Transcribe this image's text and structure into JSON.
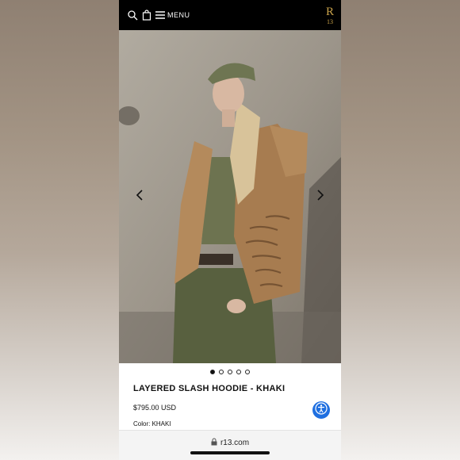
{
  "header": {
    "menu_label": "MENU",
    "logo_letter": "R",
    "logo_number": "13",
    "icons": [
      "search-icon",
      "shopping-bag-icon",
      "hamburger-icon"
    ]
  },
  "carousel": {
    "total_images": 5,
    "active_index": 0,
    "prev_icon": "chevron-left-icon",
    "next_icon": "chevron-right-icon"
  },
  "product": {
    "title": "LAYERED SLASH HOODIE - KHAKI",
    "price": "$795.00 USD",
    "color_label": "Color: KHAKI"
  },
  "accessibility_button": {
    "icon": "accessibility-icon",
    "color": "#1f6fe0"
  },
  "browser": {
    "url": "r13.com",
    "lock_icon": "lock-icon"
  },
  "colors": {
    "header_bg": "#000000",
    "logo_gold": "#c9a24a"
  }
}
